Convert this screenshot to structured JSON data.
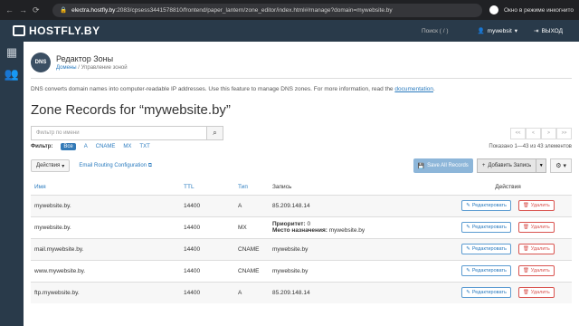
{
  "browser": {
    "back": "←",
    "forward": "→",
    "reload": "⟳",
    "url_domain": "electra.hostfly.by",
    "url_rest": ":2083/cpsess3441578810/frontend/paper_lantern/zone_editor/index.html#/manage?domain=mywebsite.by",
    "incognito_label": "Окно в режиме инкогнито"
  },
  "topbar": {
    "brand": "HOSTFLY.BY",
    "search_label": "Поиск ( / )",
    "user": "mywebsit",
    "logout": "ВЫХОД"
  },
  "header": {
    "icon_text": "DNS",
    "title": "Редактор Зоны",
    "crumb_home": "Домены",
    "crumb_sep": "/",
    "crumb_current": "Управление зоной"
  },
  "description": {
    "text": "DNS converts domain names into computer-readable IP addresses. Use this feature to manage DNS zones. For more information, read the",
    "link": "documentation",
    "tail": "."
  },
  "zone_title": "Zone Records for “mywebsite.by”",
  "filter": {
    "placeholder": "Фильтр по имени",
    "label": "Фильтр:",
    "types": [
      "Все",
      "A",
      "CNAME",
      "MX",
      "TXT"
    ],
    "count": "Показано 1—43 из 43 элементов"
  },
  "pager": [
    "<<",
    "<",
    ">",
    ">>"
  ],
  "toolbar": {
    "actions": "Действия",
    "email_routing": "Email Routing Configuration",
    "save_all": "Save All Records",
    "add_record": "Добавить Запись"
  },
  "table": {
    "headers": [
      "Имя",
      "TTL",
      "Тип",
      "Запись",
      "Действия"
    ],
    "edit_label": "Редактировать",
    "delete_label": "Удалить",
    "priority_label": "Приоритет:",
    "dest_label": "Место назначения:",
    "rows": [
      {
        "name": "mywebsite.by.",
        "ttl": "14400",
        "type": "A",
        "record": "85.209.148.14"
      },
      {
        "name": "mywebsite.by.",
        "ttl": "14400",
        "type": "MX",
        "priority": "0",
        "dest": "mywebsite.by"
      },
      {
        "name": "mail.mywebsite.by.",
        "ttl": "14400",
        "type": "CNAME",
        "record": "mywebsite.by"
      },
      {
        "name": "www.mywebsite.by.",
        "ttl": "14400",
        "type": "CNAME",
        "record": "mywebsite.by"
      },
      {
        "name": "ftp.mywebsite.by.",
        "ttl": "14400",
        "type": "A",
        "record": "85.209.148.14"
      }
    ]
  }
}
